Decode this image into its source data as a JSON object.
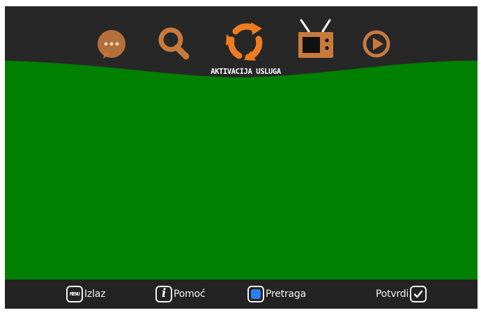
{
  "main_menu": {
    "active_label": "AKTIVACIJA USLUGA",
    "items": [
      {
        "icon": "chat-bubble-icon",
        "color": "#c87a3d"
      },
      {
        "icon": "search-icon",
        "color": "#c87a3d"
      },
      {
        "icon": "refresh-icon",
        "color": "#f07c22"
      },
      {
        "icon": "tv-icon",
        "color": "#c87a3d"
      },
      {
        "icon": "play-icon",
        "color": "#c87a3d"
      }
    ]
  },
  "footer": {
    "exit": {
      "key": "MENU",
      "label": "Izlaz"
    },
    "help": {
      "key": "i",
      "label": "Pomoć"
    },
    "search": {
      "key_color": "#2d7ff0",
      "label": "Pretraga"
    },
    "confirm": {
      "label": "Potvrdi",
      "key_icon": "checkmark-icon"
    }
  },
  "colors": {
    "background": "#262626",
    "content": "#008000",
    "accent": "#f07c22"
  }
}
